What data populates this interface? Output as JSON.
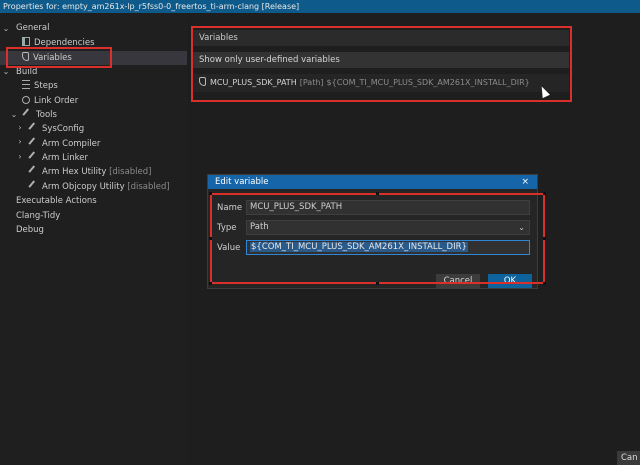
{
  "window": {
    "title": "Properties for: empty_am261x-lp_r5fss0-0_freertos_ti-arm-clang [Release]"
  },
  "tree": {
    "general": "General",
    "dependencies": "Dependencies",
    "variables": "Variables",
    "build": "Build",
    "steps": "Steps",
    "link_order": "Link Order",
    "tools": "Tools",
    "sysconfig": "SysConfig",
    "arm_compiler": "Arm Compiler",
    "arm_linker": "Arm Linker",
    "arm_hex_utility": "Arm Hex Utility",
    "arm_objcopy_utility": "Arm Objcopy Utility",
    "disabled_tag": "[disabled]",
    "executable_actions": "Executable Actions",
    "clang_tidy": "Clang-Tidy",
    "debug": "Debug"
  },
  "variables_panel": {
    "header": "Variables",
    "filter_label": "Show only user-defined variables",
    "rows": [
      {
        "name": "MCU_PLUS_SDK_PATH",
        "type": "[Path]",
        "value": "${COM_TI_MCU_PLUS_SDK_AM261X_INSTALL_DIR}"
      }
    ]
  },
  "dialog": {
    "title": "Edit variable",
    "close": "×",
    "name_label": "Name",
    "name_value": "MCU_PLUS_SDK_PATH",
    "type_label": "Type",
    "type_value": "Path",
    "value_label": "Value",
    "value_value": "${COM_TI_MCU_PLUS_SDK_AM261X_INSTALL_DIR}",
    "cancel": "Cancel",
    "ok": "OK"
  },
  "footer": {
    "cancel": "Can"
  },
  "colors": {
    "highlight": "#d9302c",
    "title_bar": "#0e5a8a",
    "dialog_title": "#1565a8",
    "primary_button": "#0e639c"
  }
}
